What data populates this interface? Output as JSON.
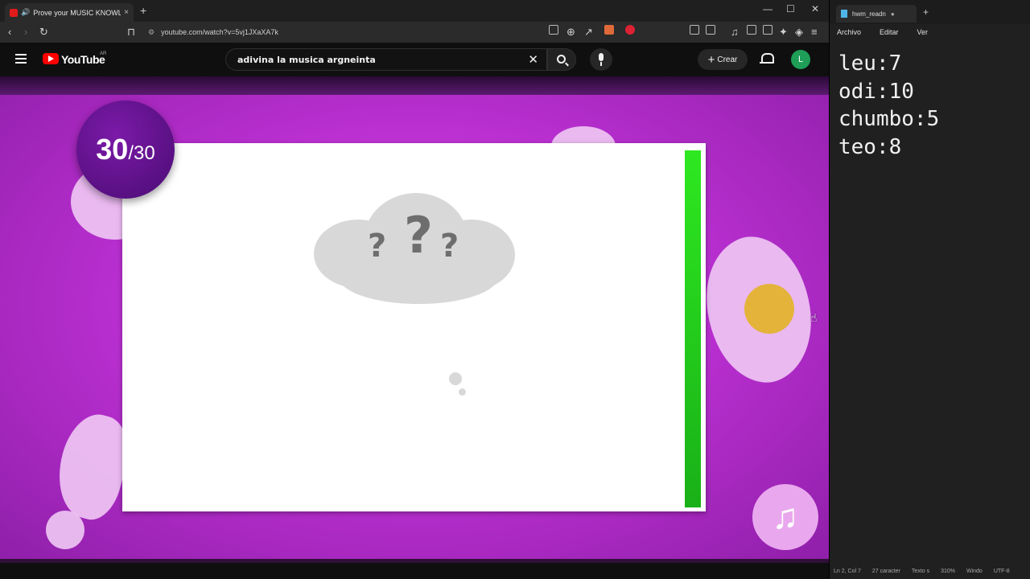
{
  "browser": {
    "tab_title": "Prove your MUSIC KNOWLEDGE",
    "url": "youtube.com/watch?v=5vj1JXaXA7k",
    "new_tab_glyph": "+",
    "close_tab_glyph": "×"
  },
  "youtube": {
    "logo_text": "YouTube",
    "country_code": "AR",
    "search_query": "adivina la musica argneinta",
    "create_label": "Crear",
    "avatar_letter": "L",
    "clear_glyph": "✕"
  },
  "video": {
    "counter_value": "30",
    "counter_total": "/30",
    "timer_fraction": 1.0,
    "colors": {
      "background": "#b92fd0",
      "timer_bar": "#22c81c",
      "coin": "#e3b33a"
    },
    "icons": [
      "question-cloud-icon",
      "music-note-icon",
      "coin-icon"
    ]
  },
  "notepad": {
    "tab_title": "hwm_readn",
    "menu": [
      "Archivo",
      "Editar",
      "Ver"
    ],
    "lines": [
      "leu:7",
      "odi:10",
      "chumbo:5",
      "teo:8"
    ],
    "status": {
      "position": "Ln 2, Col 7",
      "chars": "27 caracter",
      "format": "Texto s",
      "zoom": "310%",
      "eol": "Windo",
      "encoding": "UTF-8"
    }
  }
}
